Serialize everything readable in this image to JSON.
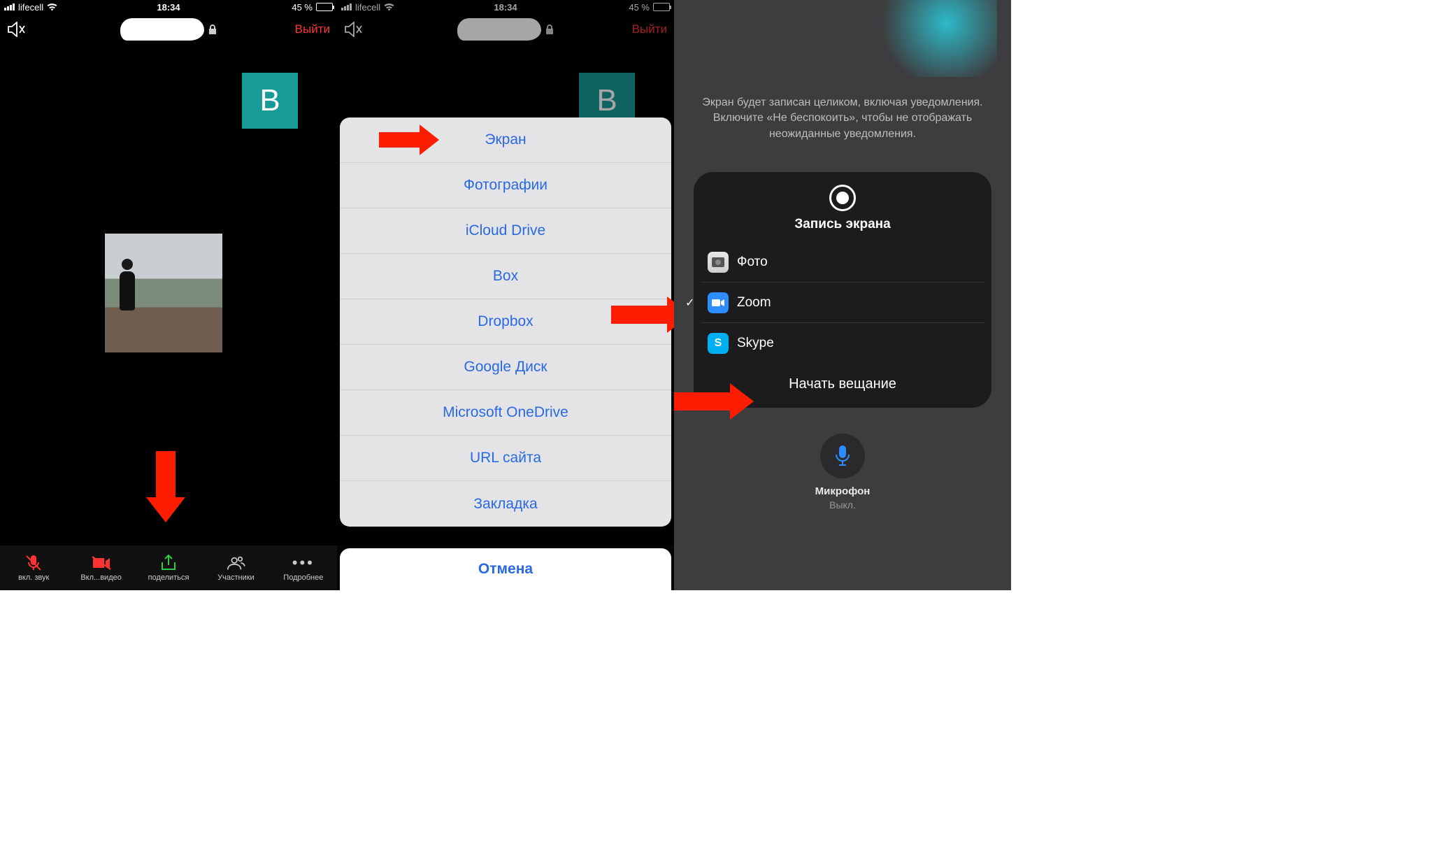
{
  "status": {
    "carrier": "lifecell",
    "time": "18:34",
    "battery_pct": "45 %"
  },
  "topnav": {
    "leave": "Выйти"
  },
  "toolbar": {
    "audio": "вкл. звук",
    "video": "Вкл...видео",
    "share": "поделиться",
    "participants": "Участники",
    "more": "Подробнее"
  },
  "avatar_letter": "B",
  "sheet": {
    "items": [
      "Экран",
      "Фотографии",
      "iCloud Drive",
      "Box",
      "Dropbox",
      "Google Диск",
      "Microsoft OneDrive",
      "URL сайта",
      "Закладка"
    ],
    "cancel": "Отмена"
  },
  "broadcast": {
    "notice": "Экран будет записан целиком, включая уведомления. Включите «Не беспокоить», чтобы не отображать неожиданные уведомления.",
    "title": "Запись экрана",
    "apps": {
      "photo": "Фото",
      "zoom": "Zoom",
      "skype": "Skype"
    },
    "start": "Начать вещание",
    "mic_label": "Микрофон",
    "mic_status": "Выкл."
  }
}
